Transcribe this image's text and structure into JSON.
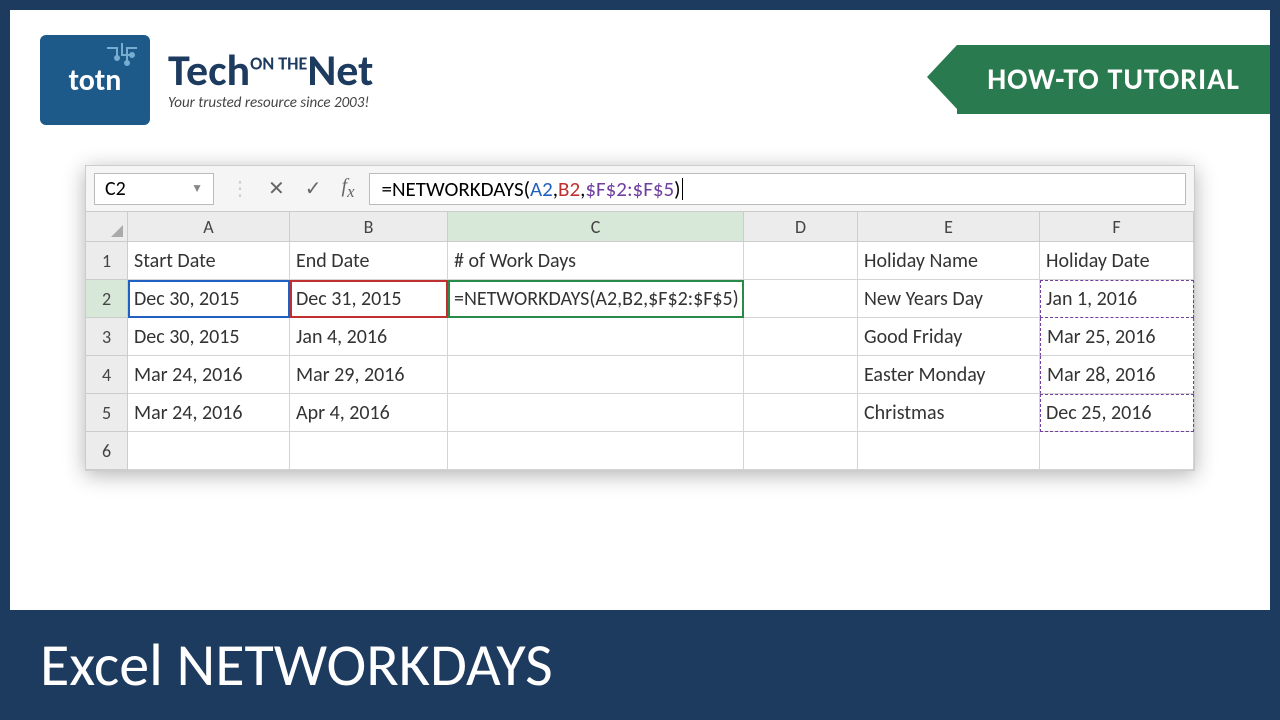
{
  "header": {
    "logo_abbrev": "totn",
    "logo_text_pre": "Tech",
    "logo_text_small": "ON THE",
    "logo_text_post": "Net",
    "tagline": "Your trusted resource since 2003!",
    "ribbon": "HOW-TO TUTORIAL"
  },
  "formula_bar": {
    "cell_ref": "C2",
    "formula_prefix": "=NETWORKDAYS(",
    "arg1": "A2",
    "arg2": "B2",
    "arg3": "$F$2:$F$5",
    "formula_suffix": ")"
  },
  "columns": [
    "A",
    "B",
    "C",
    "D",
    "E",
    "F"
  ],
  "rows": [
    "1",
    "2",
    "3",
    "4",
    "5",
    "6"
  ],
  "cells": {
    "A1": "Start Date",
    "B1": "End Date",
    "C1": "# of Work Days",
    "E1": "Holiday Name",
    "F1": "Holiday Date",
    "A2": "Dec 30, 2015",
    "B2": "Dec 31, 2015",
    "C2": "=NETWORKDAYS(A2,B2,$F$2:$F$5)",
    "E2": "New Years Day",
    "F2": "Jan 1, 2016",
    "A3": "Dec 30, 2015",
    "B3": "Jan 4, 2016",
    "E3": "Good Friday",
    "F3": "Mar 25, 2016",
    "A4": "Mar 24, 2016",
    "B4": "Mar 29, 2016",
    "E4": "Easter Monday",
    "F4": "Mar 28, 2016",
    "A5": "Mar 24, 2016",
    "B5": "Apr 4, 2016",
    "E5": "Christmas",
    "F5": "Dec 25, 2016"
  },
  "footer": "Excel NETWORKDAYS"
}
